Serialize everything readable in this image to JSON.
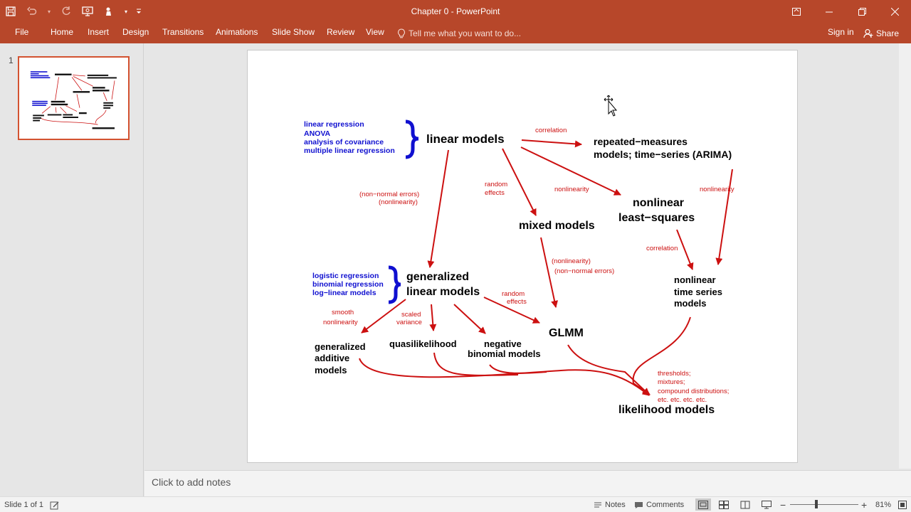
{
  "window": {
    "title": "Chapter 0 - PowerPoint"
  },
  "colors": {
    "accent": "#b7472a",
    "slide_blue": "#1010d0",
    "slide_red": "#cc1010"
  },
  "qat": {
    "icons": [
      "save-icon",
      "undo-icon",
      "redo-icon",
      "present-icon",
      "touch-mode-icon",
      "customize-icon"
    ]
  },
  "ribbon": {
    "tabs": [
      "File",
      "Home",
      "Insert",
      "Design",
      "Transitions",
      "Animations",
      "Slide Show",
      "Review",
      "View"
    ],
    "tell_me": "Tell me what you want to do...",
    "sign_in": "Sign in",
    "share": "Share"
  },
  "thumbnails": {
    "number": "1"
  },
  "slide": {
    "blue_notes": {
      "linear": [
        "linear regression",
        "ANOVA",
        "analysis of covariance",
        "multiple linear regression"
      ],
      "glm": [
        "logistic regression",
        "binomial regression",
        "log−linear models"
      ]
    },
    "nodes": {
      "linear_models": "linear models",
      "repeated": [
        "repeated−measures",
        "models; time−series (ARIMA)"
      ],
      "nls": [
        "nonlinear",
        "least−squares"
      ],
      "mixed": "mixed models",
      "glm": [
        "generalized",
        "linear models"
      ],
      "nl_ts": [
        "nonlinear",
        "time series",
        "models"
      ],
      "gam": [
        "generalized",
        "additive",
        "models"
      ],
      "quasi": "quasilikelihood",
      "negbin": [
        "negative",
        "binomial models"
      ],
      "glmm": "GLMM",
      "likelihood": "likelihood models"
    },
    "edge_labels": {
      "correlation1": "correlation",
      "random1": [
        "random",
        "effects"
      ],
      "nonlin1": "nonlinearity",
      "nonlin2": "nonlinearity",
      "nonnormal1": [
        "(non−normal errors)",
        "(nonlinearity)"
      ],
      "nonnormal2": [
        "(nonlinearity)",
        "(non−normal errors)"
      ],
      "correlation2": "correlation",
      "smooth": [
        "smooth",
        "nonlinearity"
      ],
      "scaled": [
        "scaled",
        "variance"
      ],
      "random2": [
        "random",
        "effects"
      ],
      "thresholds": [
        "thresholds;",
        "mixtures;",
        "compound distributions;",
        "etc. etc. etc. etc."
      ]
    }
  },
  "notes": {
    "placeholder": "Click to add notes"
  },
  "status": {
    "slide_info": "Slide 1 of 1",
    "notes": "Notes",
    "comments": "Comments",
    "zoom": "81%"
  }
}
